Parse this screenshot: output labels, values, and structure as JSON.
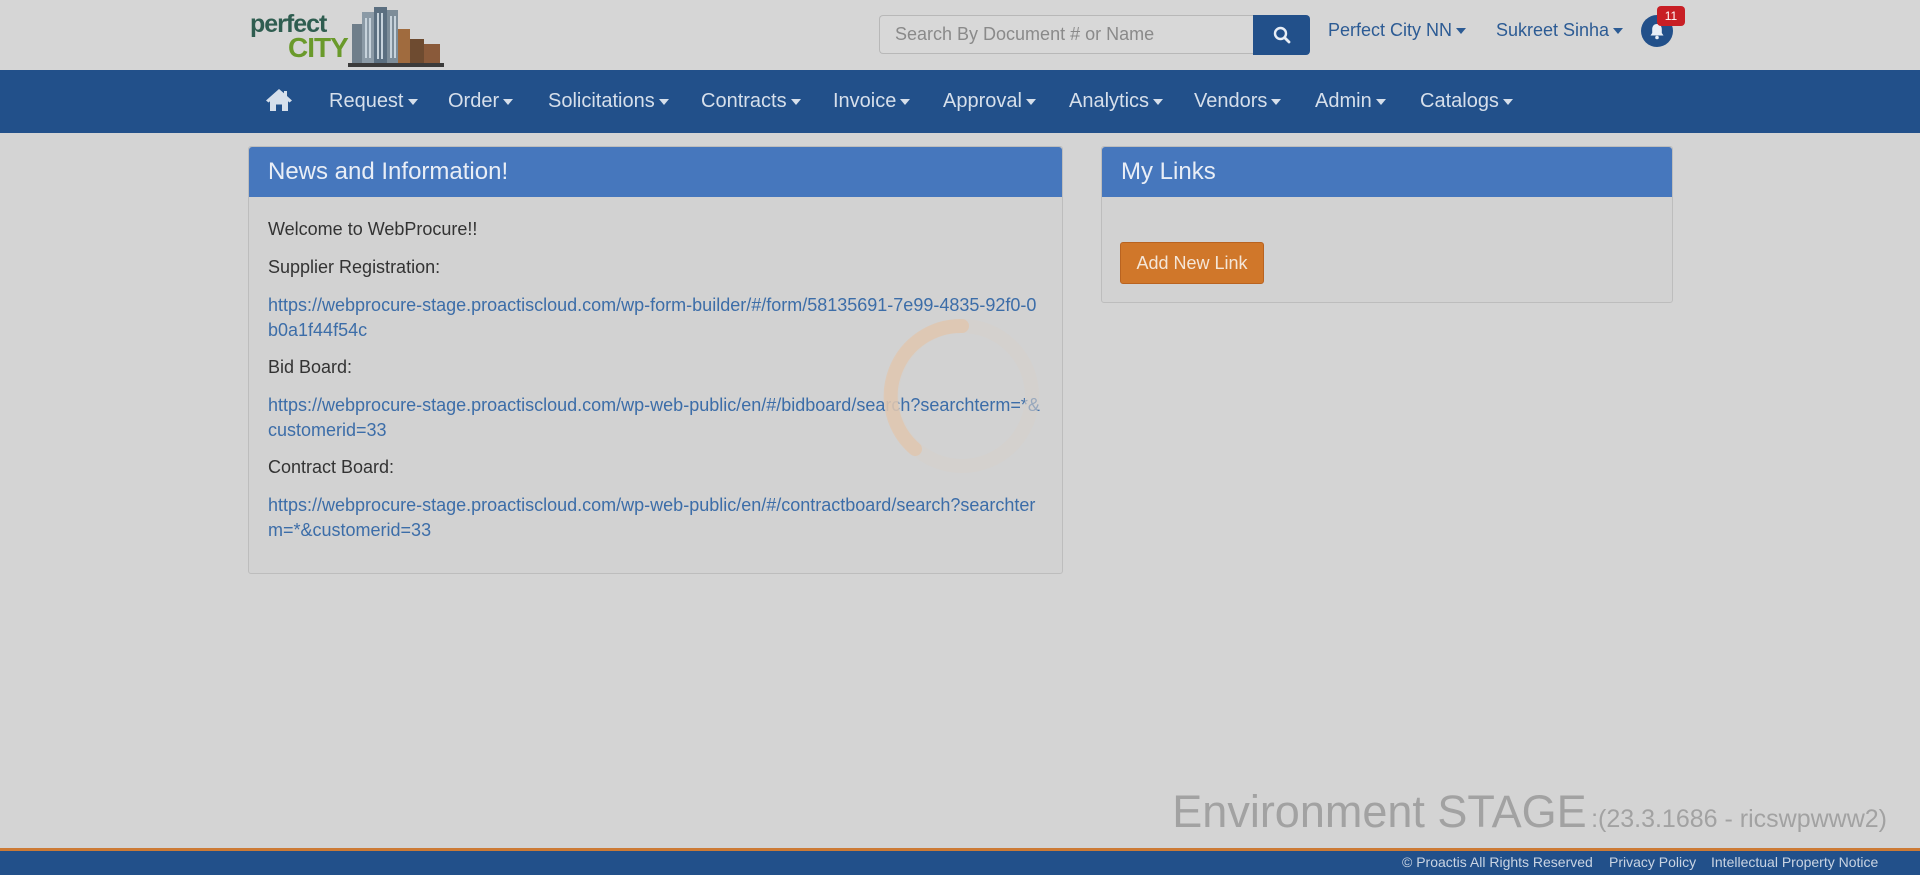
{
  "header": {
    "logo": {
      "word1": "perfect",
      "word2": "CITY"
    },
    "search": {
      "placeholder": "Search By Document # or Name"
    },
    "org_menu": "Perfect City NN",
    "user_menu": "Sukreet Sinha",
    "notifications_count": "11"
  },
  "nav": {
    "items": [
      "Request",
      "Order",
      "Solicitations",
      "Contracts",
      "Invoice",
      "Approval",
      "Analytics",
      "Vendors",
      "Admin",
      "Catalogs"
    ]
  },
  "news": {
    "title": "News and Information!",
    "welcome": "Welcome to WebProcure!!",
    "supplier_label": "Supplier Registration:",
    "supplier_url": "https://webprocure-stage.proactiscloud.com/wp-form-builder/#/form/58135691-7e99-4835-92f0-0b0a1f44f54c",
    "bid_label": "Bid Board:",
    "bid_url": "https://webprocure-stage.proactiscloud.com/wp-web-public/en/#/bidboard/search?searchterm=*&customerid=33",
    "contract_label": "Contract Board:",
    "contract_url": "https://webprocure-stage.proactiscloud.com/wp-web-public/en/#/contractboard/search?searchterm=*&customerid=33"
  },
  "links": {
    "title": "My Links",
    "add_button": "Add New Link"
  },
  "environment": {
    "label": "Environment STAGE",
    "version": ":(23.3.1686 - ricswpwww2)"
  },
  "footer": {
    "copyright": "© Proactis All Rights Reserved",
    "privacy": "Privacy Policy",
    "ip_notice": "Intellectual Property Notice"
  },
  "colors": {
    "nav": "#22508a",
    "panel_header": "#4677bd",
    "accent": "#d0772a",
    "badge": "#c81f25"
  }
}
